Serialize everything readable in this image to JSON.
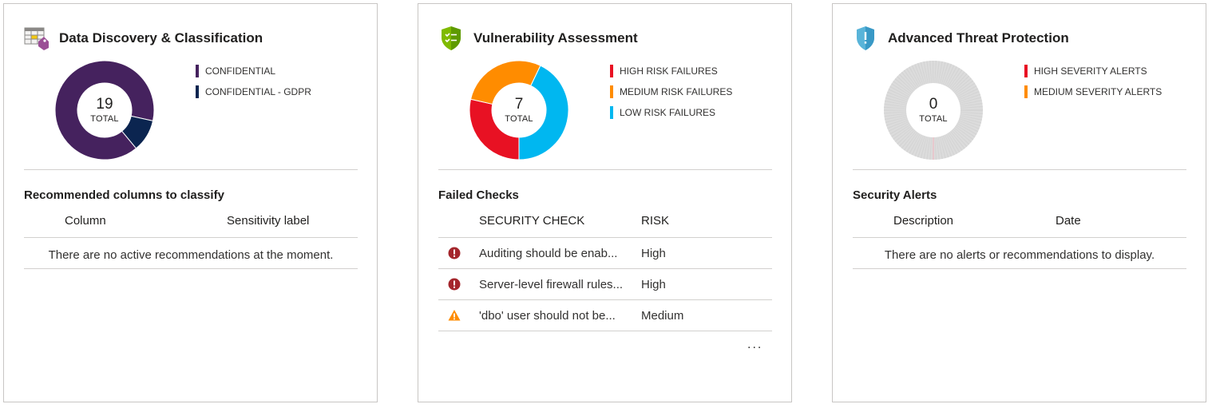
{
  "colors": {
    "confidential": "#45225e",
    "confidential_gdpr": "#0b2550",
    "high": "#e81123",
    "medium": "#ff8c00",
    "low": "#00b7f0",
    "none": "#dcdcdc",
    "error_icon": "#a4262c",
    "warning_icon": "#ff8c00"
  },
  "cards": [
    {
      "title": "Data Discovery & Classification",
      "icon": "table-tag-icon",
      "total": "19",
      "total_label": "TOTAL",
      "legend": [
        "CONFIDENTIAL",
        "CONFIDENTIAL - GDPR"
      ],
      "chart_data": {
        "type": "pie",
        "categories": [
          "CONFIDENTIAL",
          "CONFIDENTIAL - GDPR"
        ],
        "values": [
          17,
          2
        ]
      },
      "section_title": "Recommended columns to classify",
      "columns": [
        "Column",
        "Sensitivity label"
      ],
      "empty_message": "There are no active recommendations at the moment."
    },
    {
      "title": "Vulnerability Assessment",
      "icon": "shield-check-icon",
      "total": "7",
      "total_label": "TOTAL",
      "legend": [
        "HIGH RISK FAILURES",
        "MEDIUM RISK FAILURES",
        "LOW RISK FAILURES"
      ],
      "chart_data": {
        "type": "pie",
        "categories": [
          "HIGH RISK FAILURES",
          "MEDIUM RISK FAILURES",
          "LOW RISK FAILURES"
        ],
        "values": [
          2,
          2,
          3
        ]
      },
      "section_title": "Failed Checks",
      "columns": [
        "SECURITY CHECK",
        "RISK"
      ],
      "rows": [
        {
          "icon": "error-icon",
          "check": "Auditing should be enab...",
          "risk": "High"
        },
        {
          "icon": "error-icon",
          "check": "Server-level firewall rules...",
          "risk": "High"
        },
        {
          "icon": "warning-icon",
          "check": "'dbo' user should not be...",
          "risk": "Medium"
        }
      ],
      "more": "..."
    },
    {
      "title": "Advanced Threat Protection",
      "icon": "shield-alert-icon",
      "total": "0",
      "total_label": "TOTAL",
      "legend": [
        "HIGH SEVERITY ALERTS",
        "MEDIUM SEVERITY ALERTS"
      ],
      "chart_data": {
        "type": "pie",
        "categories": [
          "HIGH SEVERITY ALERTS",
          "MEDIUM SEVERITY ALERTS"
        ],
        "values": [
          0,
          0
        ]
      },
      "section_title": "Security Alerts",
      "columns": [
        "Description",
        "Date"
      ],
      "empty_message": "There are no alerts or recommendations to display."
    }
  ]
}
